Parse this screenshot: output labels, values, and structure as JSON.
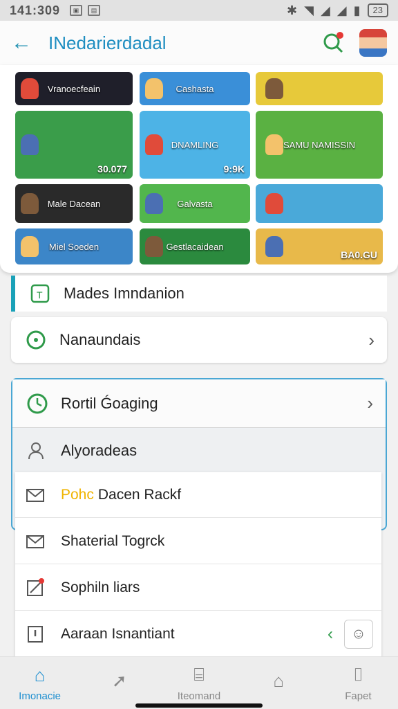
{
  "status": {
    "time": "141:309",
    "battery": "23"
  },
  "appbar": {
    "title": "INedarierdadal"
  },
  "tiles": [
    {
      "label": "Vranoecfeain",
      "bg": "#1f1f2a"
    },
    {
      "label": "Cashasta",
      "bg": "#3a8fd8"
    },
    {
      "label": "",
      "bg": "#e7c93a"
    },
    {
      "label": "",
      "bg": "#3a9d4a",
      "num": "30.077"
    },
    {
      "label": "DNAMLING",
      "bg": "#4db3e6",
      "num": "9:9K"
    },
    {
      "label": "SAMU NAMISSIN",
      "bg": "#5ab142"
    },
    {
      "label": "Male Dacean",
      "bg": "#2a2a2a"
    },
    {
      "label": "Galvasta",
      "bg": "#52b64d"
    },
    {
      "label": "",
      "bg": "#4aa9d9"
    },
    {
      "label": "Miel Soeden",
      "bg": "#3c86c8"
    },
    {
      "label": "Gestlacaidean",
      "bg": "#2b8a3e"
    },
    {
      "label": "",
      "bg": "#e8b94a",
      "num": "BA0.GU"
    }
  ],
  "rows": {
    "r1": "Mades Imndanion",
    "r2": "Nanaundais",
    "r3": "Rortil Ǵoaging",
    "r4": "Alyoradeas"
  },
  "list": [
    {
      "prefix": "Pohc",
      "text": "Dacen Rackf"
    },
    {
      "prefix": "",
      "text": "Shaterial Togrck"
    },
    {
      "prefix": "",
      "text": "Sophiln liars"
    },
    {
      "prefix": "",
      "text": "Aaraan Isnantiant"
    }
  ],
  "nav": [
    {
      "label": "Imonacie"
    },
    {
      "label": ""
    },
    {
      "label": "Iteomand"
    },
    {
      "label": ""
    },
    {
      "label": "Fapet"
    }
  ],
  "colors": {
    "accent": "#1f8ec1",
    "active": "#1e8fd0"
  }
}
